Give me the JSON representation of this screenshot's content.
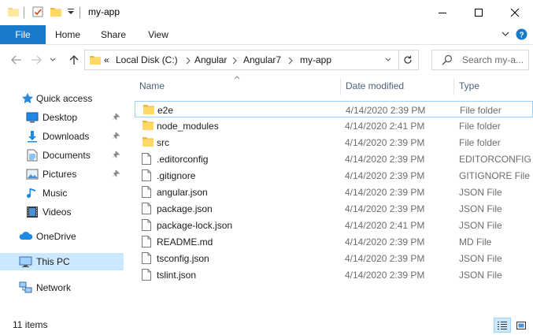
{
  "window": {
    "title": "my-app",
    "accent": "#1979ca"
  },
  "ribbon": {
    "tabs": [
      "File",
      "Home",
      "Share",
      "View"
    ]
  },
  "address": {
    "overflow": "«",
    "crumbs": [
      "Local Disk (C:)",
      "Angular",
      "Angular7",
      "my-app"
    ]
  },
  "search": {
    "placeholder": "Search my-a..."
  },
  "nav": {
    "quick_access": "Quick access",
    "items": [
      "Desktop",
      "Downloads",
      "Documents",
      "Pictures",
      "Music",
      "Videos"
    ],
    "onedrive": "OneDrive",
    "this_pc": "This PC",
    "network": "Network"
  },
  "columns": {
    "name": "Name",
    "date": "Date modified",
    "type": "Type"
  },
  "files": [
    {
      "name": "e2e",
      "date": "4/14/2020 2:39 PM",
      "type": "File folder",
      "icon": "folder-icon"
    },
    {
      "name": "node_modules",
      "date": "4/14/2020 2:41 PM",
      "type": "File folder",
      "icon": "folder-icon"
    },
    {
      "name": "src",
      "date": "4/14/2020 2:39 PM",
      "type": "File folder",
      "icon": "folder-icon"
    },
    {
      "name": ".editorconfig",
      "date": "4/14/2020 2:39 PM",
      "type": "EDITORCONFIG File",
      "icon": "file-icon"
    },
    {
      "name": ".gitignore",
      "date": "4/14/2020 2:39 PM",
      "type": "GITIGNORE File",
      "icon": "file-icon"
    },
    {
      "name": "angular.json",
      "date": "4/14/2020 2:39 PM",
      "type": "JSON File",
      "icon": "file-icon"
    },
    {
      "name": "package.json",
      "date": "4/14/2020 2:39 PM",
      "type": "JSON File",
      "icon": "file-icon"
    },
    {
      "name": "package-lock.json",
      "date": "4/14/2020 2:41 PM",
      "type": "JSON File",
      "icon": "file-icon"
    },
    {
      "name": "README.md",
      "date": "4/14/2020 2:39 PM",
      "type": "MD File",
      "icon": "file-icon"
    },
    {
      "name": "tsconfig.json",
      "date": "4/14/2020 2:39 PM",
      "type": "JSON File",
      "icon": "file-icon"
    },
    {
      "name": "tslint.json",
      "date": "4/14/2020 2:39 PM",
      "type": "JSON File",
      "icon": "file-icon"
    }
  ],
  "status": {
    "count": "11 items"
  }
}
